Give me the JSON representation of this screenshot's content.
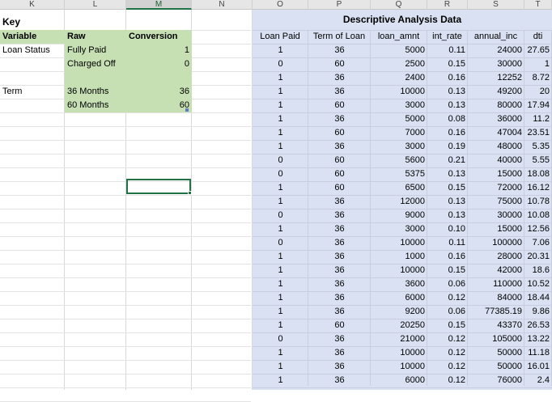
{
  "columns": [
    "K",
    "L",
    "M",
    "N",
    "O",
    "P",
    "Q",
    "R",
    "S",
    "T"
  ],
  "selected_column": "M",
  "key": {
    "title": "Key",
    "headers": [
      "Variable",
      "Raw",
      "Conversion"
    ],
    "rows": [
      {
        "variable": "Loan Status",
        "raw": "Fully Paid",
        "conversion": "1"
      },
      {
        "variable": "",
        "raw": "Charged Off",
        "conversion": "0"
      },
      {
        "variable": "",
        "raw": "",
        "conversion": ""
      },
      {
        "variable": "Term",
        "raw": "36 Months",
        "conversion": "36"
      },
      {
        "variable": "",
        "raw": "60 Months",
        "conversion": "60"
      }
    ]
  },
  "analysis": {
    "title": "Descriptive Analysis Data",
    "headers": [
      "Loan Paid",
      "Term of Loan",
      "loan_amnt",
      "int_rate",
      "annual_inc",
      "dti"
    ],
    "rows": [
      [
        "1",
        "36",
        "5000",
        "0.11",
        "24000",
        "27.65"
      ],
      [
        "0",
        "60",
        "2500",
        "0.15",
        "30000",
        "1"
      ],
      [
        "1",
        "36",
        "2400",
        "0.16",
        "12252",
        "8.72"
      ],
      [
        "1",
        "36",
        "10000",
        "0.13",
        "49200",
        "20"
      ],
      [
        "1",
        "60",
        "3000",
        "0.13",
        "80000",
        "17.94"
      ],
      [
        "1",
        "36",
        "5000",
        "0.08",
        "36000",
        "11.2"
      ],
      [
        "1",
        "60",
        "7000",
        "0.16",
        "47004",
        "23.51"
      ],
      [
        "1",
        "36",
        "3000",
        "0.19",
        "48000",
        "5.35"
      ],
      [
        "0",
        "60",
        "5600",
        "0.21",
        "40000",
        "5.55"
      ],
      [
        "0",
        "60",
        "5375",
        "0.13",
        "15000",
        "18.08"
      ],
      [
        "1",
        "60",
        "6500",
        "0.15",
        "72000",
        "16.12"
      ],
      [
        "1",
        "36",
        "12000",
        "0.13",
        "75000",
        "10.78"
      ],
      [
        "0",
        "36",
        "9000",
        "0.13",
        "30000",
        "10.08"
      ],
      [
        "1",
        "36",
        "3000",
        "0.10",
        "15000",
        "12.56"
      ],
      [
        "0",
        "36",
        "10000",
        "0.11",
        "100000",
        "7.06"
      ],
      [
        "1",
        "36",
        "1000",
        "0.16",
        "28000",
        "20.31"
      ],
      [
        "1",
        "36",
        "10000",
        "0.15",
        "42000",
        "18.6"
      ],
      [
        "1",
        "36",
        "3600",
        "0.06",
        "110000",
        "10.52"
      ],
      [
        "1",
        "36",
        "6000",
        "0.12",
        "84000",
        "18.44"
      ],
      [
        "1",
        "36",
        "9200",
        "0.06",
        "77385.19",
        "9.86"
      ],
      [
        "1",
        "60",
        "20250",
        "0.15",
        "43370",
        "26.53"
      ],
      [
        "0",
        "36",
        "21000",
        "0.12",
        "105000",
        "13.22"
      ],
      [
        "1",
        "36",
        "10000",
        "0.12",
        "50000",
        "11.18"
      ],
      [
        "1",
        "36",
        "10000",
        "0.12",
        "50000",
        "16.01"
      ],
      [
        "1",
        "36",
        "6000",
        "0.12",
        "76000",
        "2.4"
      ]
    ]
  }
}
